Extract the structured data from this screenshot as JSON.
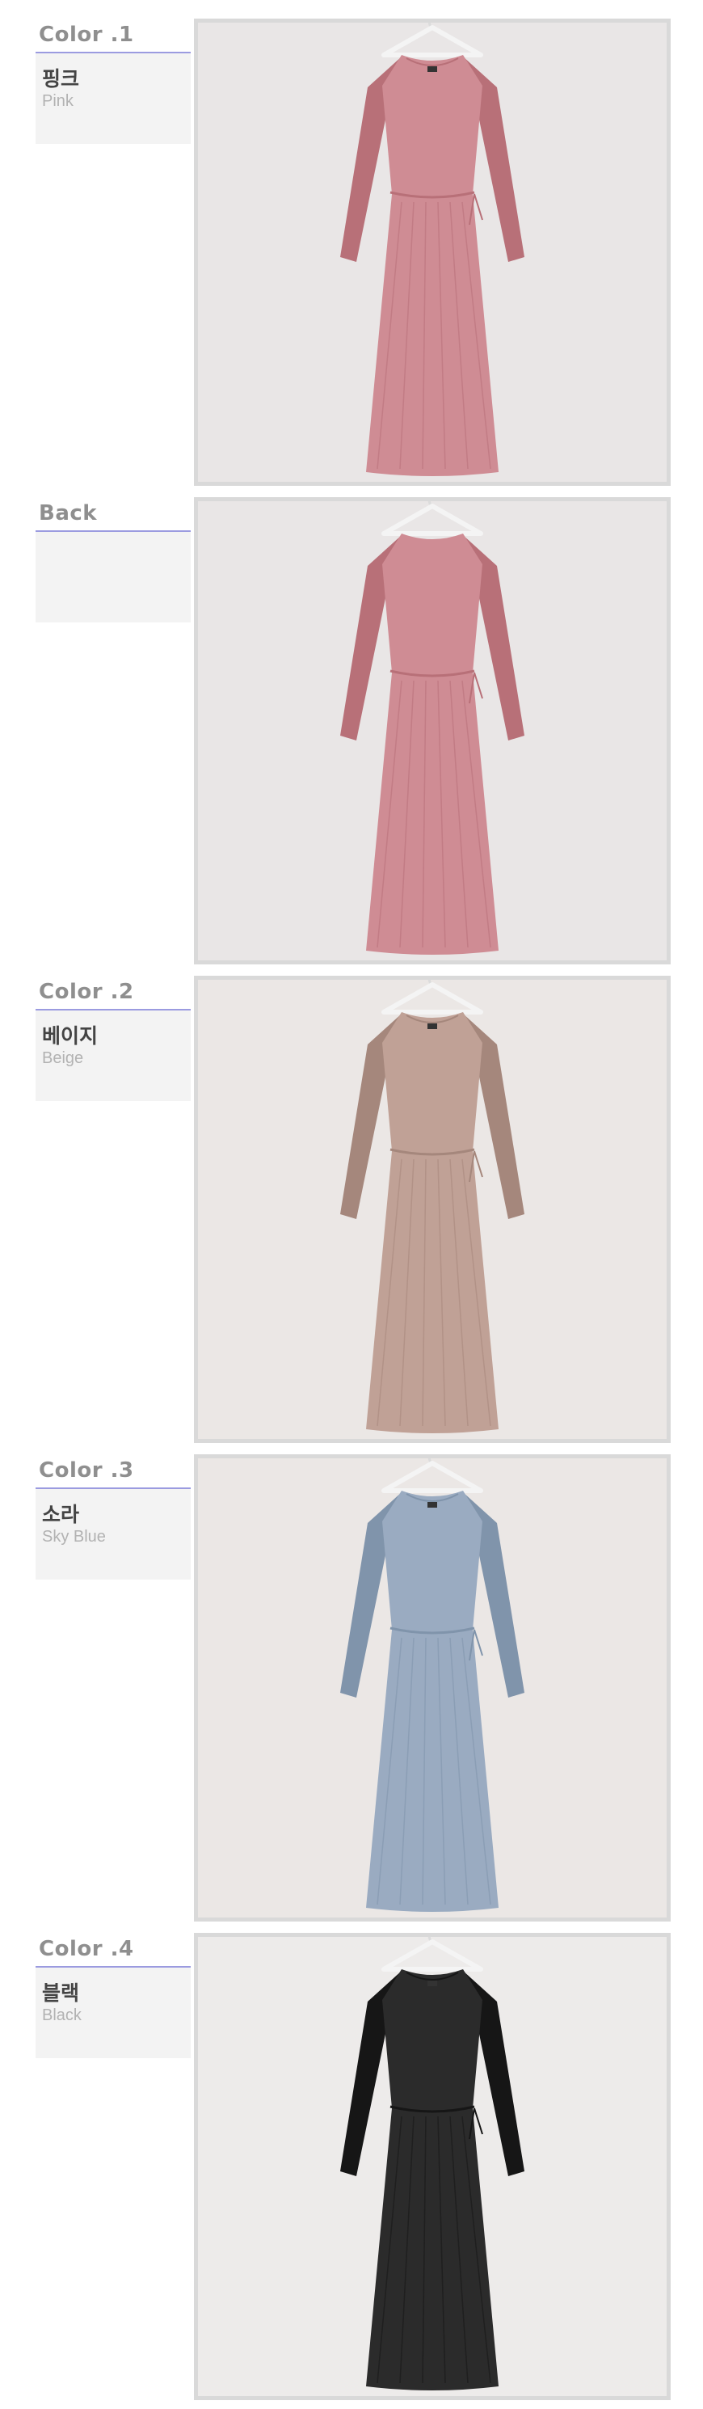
{
  "sections": [
    {
      "title": "Color .1",
      "kor": "핑크",
      "eng": "Pink",
      "dress_color": "#cf8c94",
      "dress_shade": "#b87078",
      "bg_color": "#e9e6e6",
      "photo": "pink dress front"
    },
    {
      "title": "Back",
      "kor": "",
      "eng": "",
      "dress_color": "#cf8c94",
      "dress_shade": "#b87078",
      "bg_color": "#e9e6e6",
      "photo": "pink dress back"
    },
    {
      "title": "Color .2",
      "kor": "베이지",
      "eng": "Beige",
      "dress_color": "#c0a196",
      "dress_shade": "#a5877c",
      "bg_color": "#ebe7e5",
      "photo": "beige dress front"
    },
    {
      "title": "Color .3",
      "kor": "소라",
      "eng": "Sky Blue",
      "dress_color": "#9aabc1",
      "dress_shade": "#8094ab",
      "bg_color": "#ebe7e5",
      "photo": "sky blue dress front"
    },
    {
      "title": "Color .4",
      "kor": "블랙",
      "eng": "Black",
      "dress_color": "#2b2b2b",
      "dress_shade": "#161616",
      "bg_color": "#edebea",
      "photo": "black dress front"
    }
  ]
}
